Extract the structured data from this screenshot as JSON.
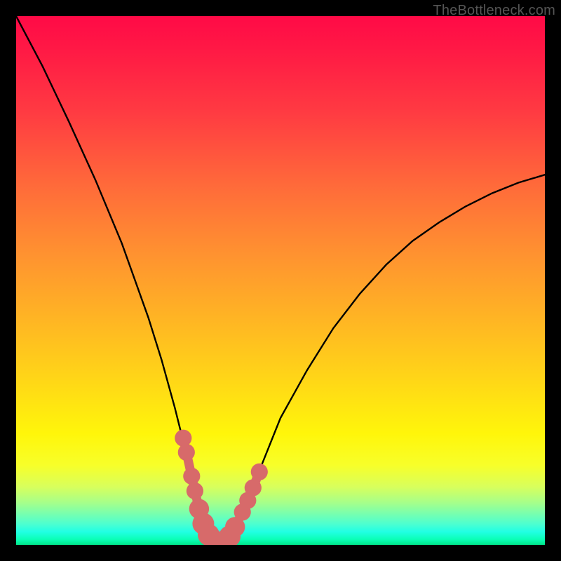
{
  "watermark": "TheBottleneck.com",
  "colors": {
    "frame": "#000000",
    "gradient_top": "#ff0a46",
    "gradient_mid": "#ffd418",
    "gradient_bottom": "#00e58a",
    "curve": "#000000",
    "markers": "#d76a6a"
  },
  "chart_data": {
    "type": "line",
    "title": "",
    "xlabel": "",
    "ylabel": "",
    "xlim": [
      0,
      100
    ],
    "ylim": [
      0,
      100
    ],
    "series": [
      {
        "name": "bottleneck-curve",
        "x": [
          0,
          5,
          10,
          15,
          20,
          25,
          27.5,
          30,
          32,
          34,
          35,
          36,
          37,
          38,
          39,
          40,
          41,
          42,
          44,
          46,
          50,
          55,
          60,
          65,
          70,
          75,
          80,
          85,
          90,
          95,
          100
        ],
        "y": [
          100,
          90.5,
          80,
          69,
          57,
          43,
          35,
          26,
          18,
          10,
          6,
          3,
          1.2,
          0.4,
          0.2,
          0.4,
          1.2,
          3,
          8,
          14,
          24,
          33,
          41,
          47.5,
          53,
          57.5,
          61,
          64,
          66.5,
          68.5,
          70
        ]
      }
    ],
    "markers": [
      {
        "x": 31.6,
        "y": 20.2,
        "r": 1.2
      },
      {
        "x": 32.2,
        "y": 17.5,
        "r": 1.2
      },
      {
        "x": 33.2,
        "y": 13.0,
        "r": 1.2
      },
      {
        "x": 33.8,
        "y": 10.2,
        "r": 1.2
      },
      {
        "x": 34.6,
        "y": 6.8,
        "r": 1.5
      },
      {
        "x": 35.4,
        "y": 4.0,
        "r": 1.7
      },
      {
        "x": 36.4,
        "y": 1.9,
        "r": 1.7
      },
      {
        "x": 37.4,
        "y": 0.8,
        "r": 1.7
      },
      {
        "x": 38.4,
        "y": 0.3,
        "r": 1.7
      },
      {
        "x": 39.4,
        "y": 0.6,
        "r": 1.7
      },
      {
        "x": 40.4,
        "y": 1.6,
        "r": 1.7
      },
      {
        "x": 41.4,
        "y": 3.4,
        "r": 1.5
      },
      {
        "x": 42.8,
        "y": 6.2,
        "r": 1.2
      },
      {
        "x": 43.8,
        "y": 8.4,
        "r": 1.2
      },
      {
        "x": 44.8,
        "y": 10.8,
        "r": 1.2
      },
      {
        "x": 46.0,
        "y": 13.8,
        "r": 1.2
      }
    ]
  }
}
